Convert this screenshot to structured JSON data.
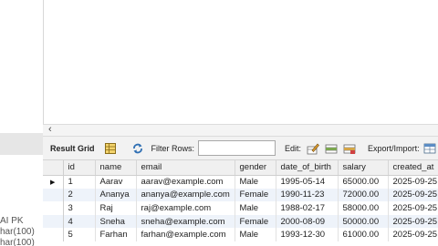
{
  "left_pane": {
    "fragment_1": "AI PK",
    "fragment_2": "har(100)",
    "fragment_3": "har(100)"
  },
  "toolbar": {
    "result_grid_label": "Result Grid",
    "filter_rows_label": "Filter Rows:",
    "filter_rows_value": "",
    "edit_label": "Edit:",
    "export_import_label": "Export/Import:"
  },
  "grid": {
    "columns": [
      "id",
      "name",
      "email",
      "gender",
      "date_of_birth",
      "salary",
      "created_at"
    ],
    "rows": [
      [
        "1",
        "Aarav",
        "aarav@example.com",
        "Male",
        "1995-05-14",
        "65000.00",
        "2025-09-25"
      ],
      [
        "2",
        "Ananya",
        "ananya@example.com",
        "Female",
        "1990-11-23",
        "72000.00",
        "2025-09-25"
      ],
      [
        "3",
        "Raj",
        "raj@example.com",
        "Male",
        "1988-02-17",
        "58000.00",
        "2025-09-25"
      ],
      [
        "4",
        "Sneha",
        "sneha@example.com",
        "Female",
        "2000-08-09",
        "50000.00",
        "2025-09-25"
      ],
      [
        "5",
        "Farhan",
        "farhan@example.com",
        "Male",
        "1993-12-30",
        "61000.00",
        "2025-09-25"
      ]
    ],
    "current_row_marker": "▶"
  },
  "icons": {
    "grid_view": "grid-view-icon",
    "filter": "filter-refresh-icon",
    "edit_row": "edit-row-icon",
    "add_row": "add-row-icon",
    "delete_row": "delete-row-icon",
    "export": "export-icon",
    "scroll_left": "scroll-left-icon"
  },
  "colors": {
    "alt_row": "#eef3fa",
    "toolbar_bg": "#f2f2f2",
    "header_bg": "#f0f0f0"
  }
}
